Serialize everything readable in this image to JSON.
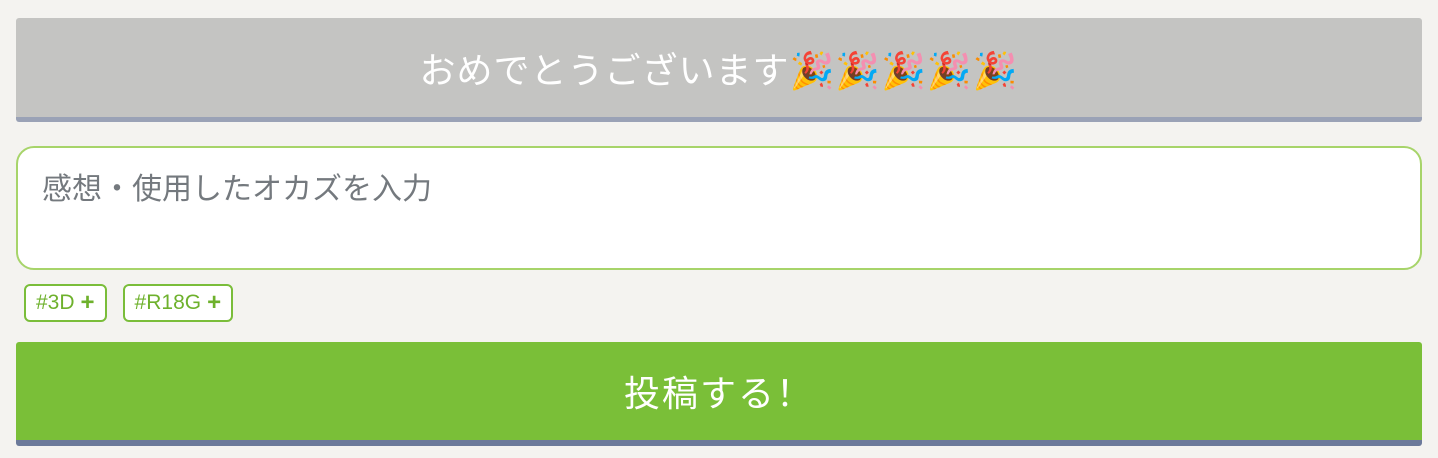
{
  "congrats": {
    "text": "おめでとうございます🎉🎉🎉🎉🎉"
  },
  "comment": {
    "value": "",
    "placeholder": "感想・使用したオカズを入力"
  },
  "tags": [
    {
      "label": "#3D",
      "plus": "+"
    },
    {
      "label": "#R18G",
      "plus": "+"
    }
  ],
  "submit": {
    "label": "投稿する！"
  },
  "colors": {
    "background": "#f4f3f0",
    "banner": "#c4c4c2",
    "accent_green": "#7abf38",
    "input_border": "#a7d46a"
  }
}
